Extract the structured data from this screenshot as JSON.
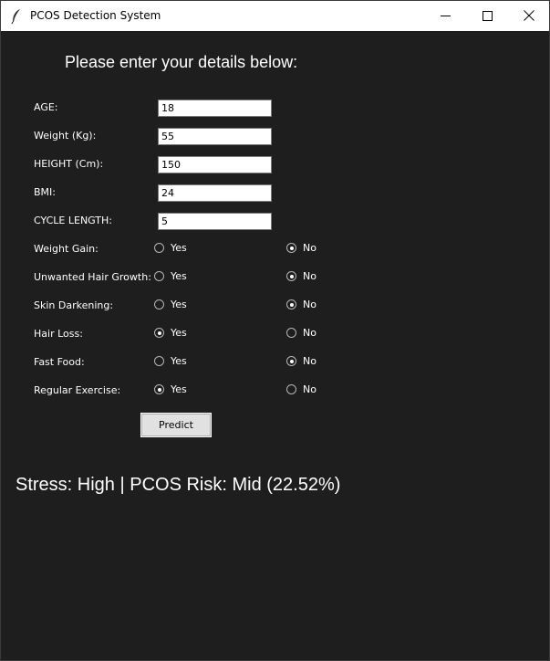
{
  "window": {
    "title": "PCOS Detection System"
  },
  "heading": "Please enter your details below:",
  "fields": [
    {
      "label": "AGE:",
      "value": "18"
    },
    {
      "label": "Weight (Kg):",
      "value": "55"
    },
    {
      "label": "HEIGHT (Cm):",
      "value": "150"
    },
    {
      "label": "BMI:",
      "value": "24"
    },
    {
      "label": "CYCLE LENGTH:",
      "value": "5"
    }
  ],
  "radios": [
    {
      "label": "Weight Gain:",
      "yes": "Yes",
      "no": "No",
      "selected": "No"
    },
    {
      "label": "Unwanted Hair Growth:",
      "yes": "Yes",
      "no": "No",
      "selected": "No"
    },
    {
      "label": "Skin Darkening:",
      "yes": "Yes",
      "no": "No",
      "selected": "No"
    },
    {
      "label": "Hair Loss:",
      "yes": "Yes",
      "no": "No",
      "selected": "Yes"
    },
    {
      "label": "Fast Food:",
      "yes": "Yes",
      "no": "No",
      "selected": "No"
    },
    {
      "label": "Regular Exercise:",
      "yes": "Yes",
      "no": "No",
      "selected": "Yes"
    }
  ],
  "predict_label": "Predict",
  "result": "Stress: High | PCOS Risk: Mid (22.52%)",
  "icons": {
    "app": "feather-icon",
    "minimize": "minimize-icon",
    "maximize": "maximize-icon",
    "close": "close-icon"
  }
}
